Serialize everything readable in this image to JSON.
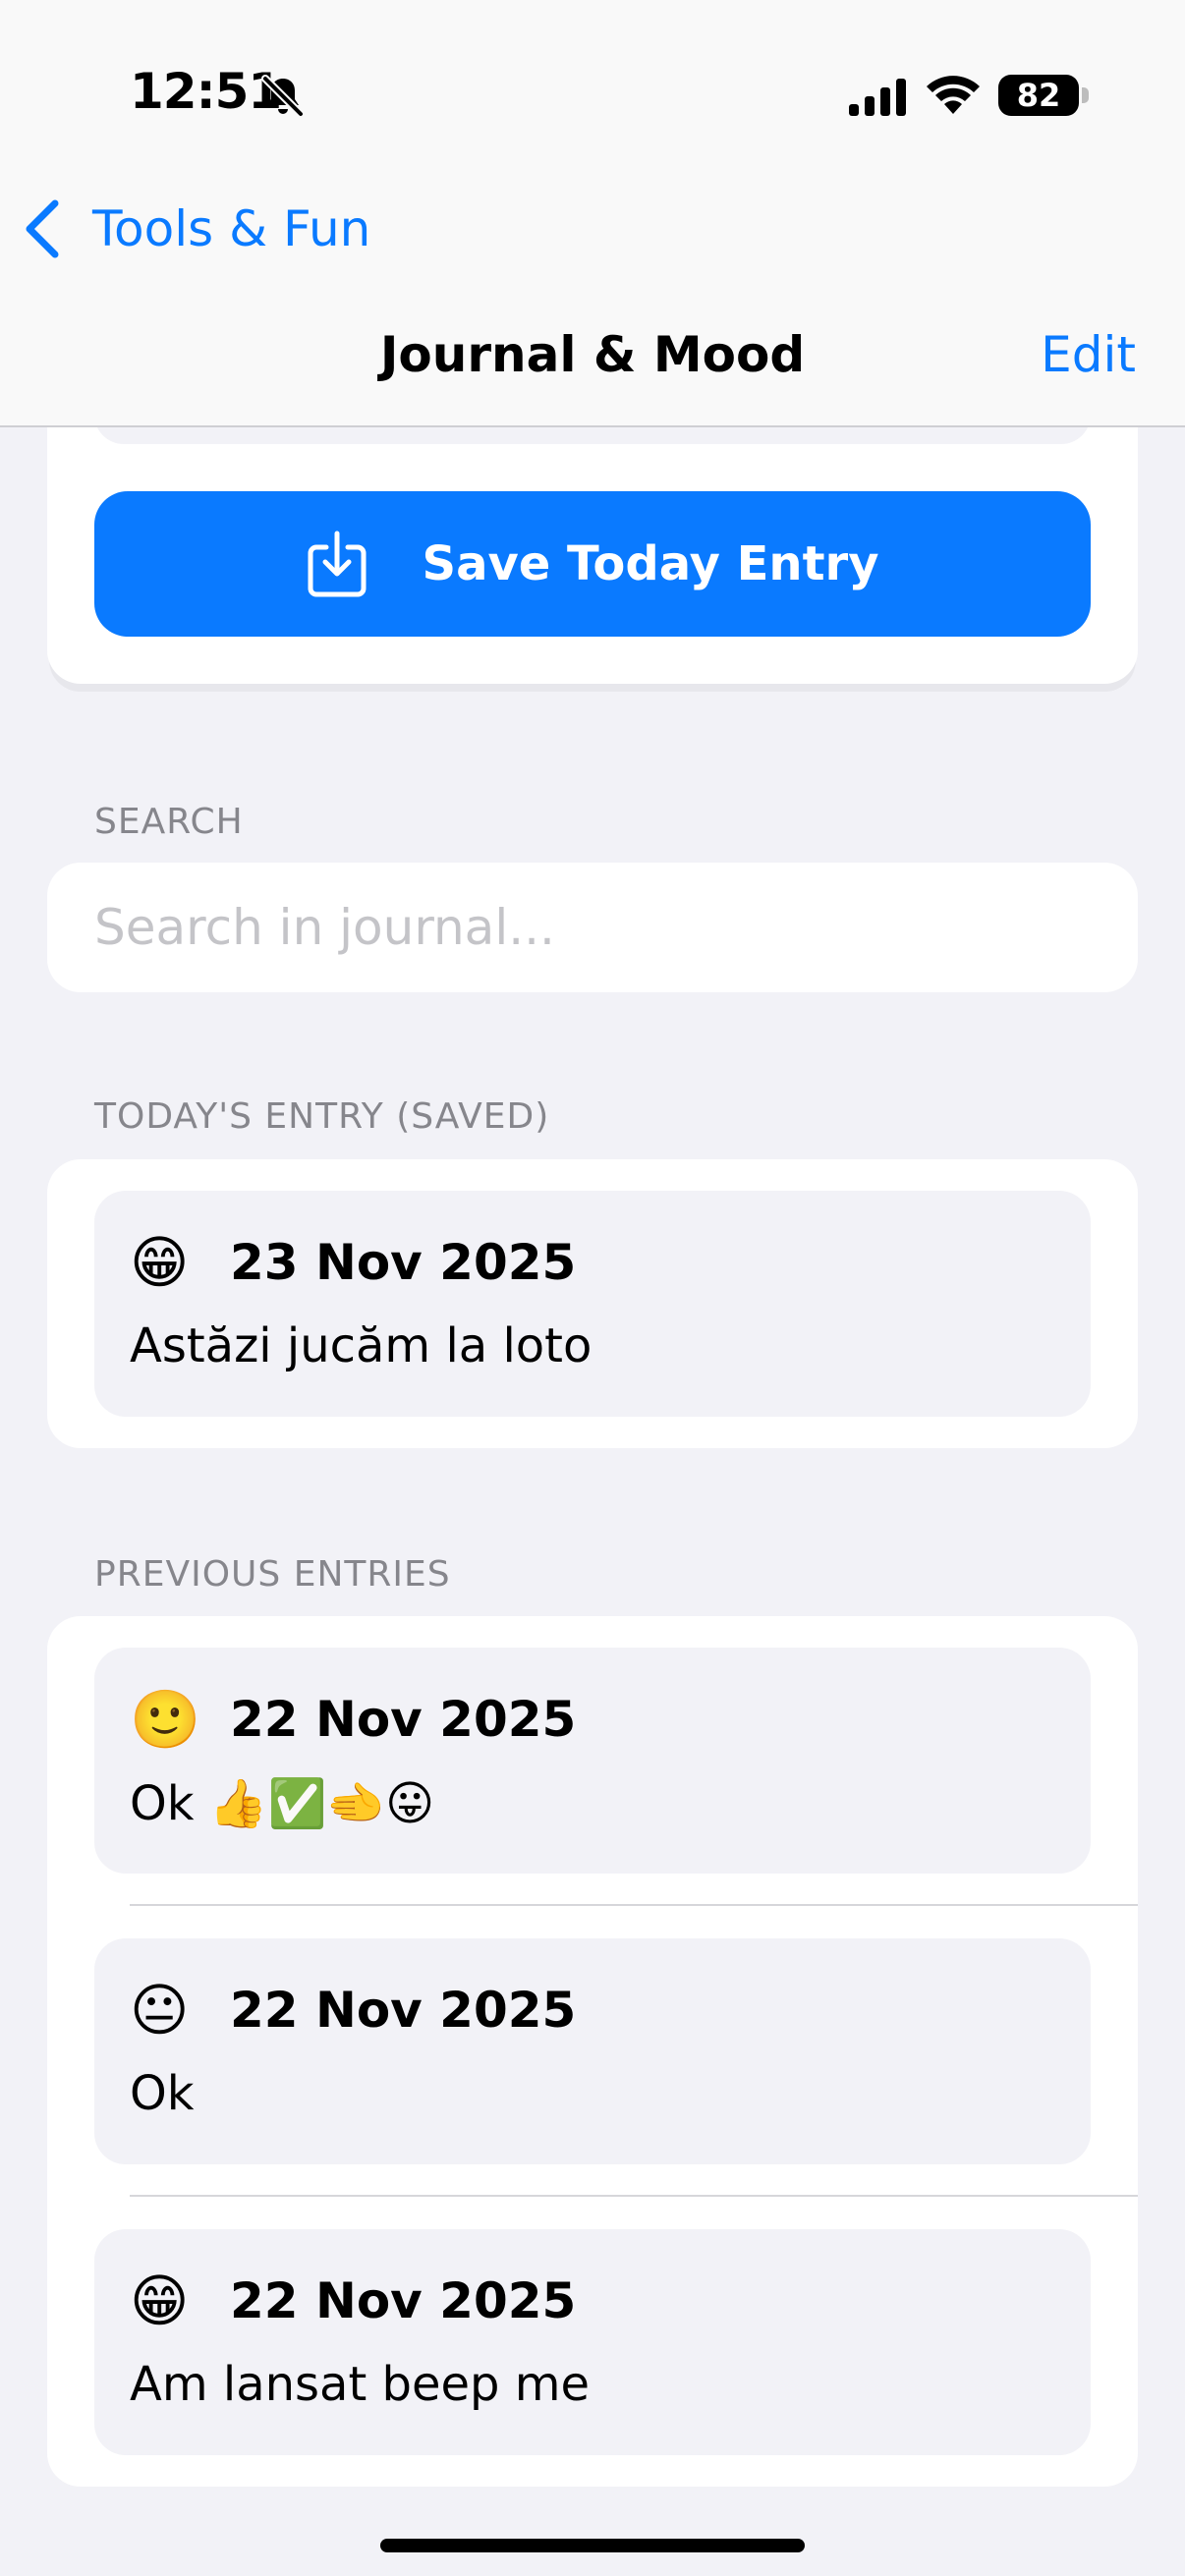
{
  "status": {
    "time": "12:51",
    "battery": "82"
  },
  "nav": {
    "back_label": "Tools & Fun",
    "title": "Journal & Mood",
    "edit_label": "Edit"
  },
  "save": {
    "label": "Save Today Entry"
  },
  "search": {
    "header": "SEARCH",
    "placeholder": "Search in journal..."
  },
  "today": {
    "header": "TODAY'S ENTRY (SAVED)",
    "entry": {
      "emoji": "😁",
      "date": "23 Nov 2025",
      "text": "Astăzi jucăm la loto"
    }
  },
  "previous": {
    "header": "PREVIOUS ENTRIES",
    "entries": [
      {
        "emoji": "🙂",
        "date": "22 Nov 2025",
        "text": "Ok 👍✅🫲😛"
      },
      {
        "emoji": "😐",
        "date": "22 Nov 2025",
        "text": "Ok"
      },
      {
        "emoji": "😁",
        "date": "22 Nov 2025",
        "text": "Am lansat beep me"
      }
    ]
  },
  "colors": {
    "accent": "#0A7AFF",
    "background": "#F2F2F7"
  },
  "icons": {
    "bell": "bell-slash-icon",
    "signal": "cellular-signal-icon",
    "wifi": "wifi-icon",
    "back": "chevron-left-icon",
    "save": "tray-arrow-down-icon"
  }
}
